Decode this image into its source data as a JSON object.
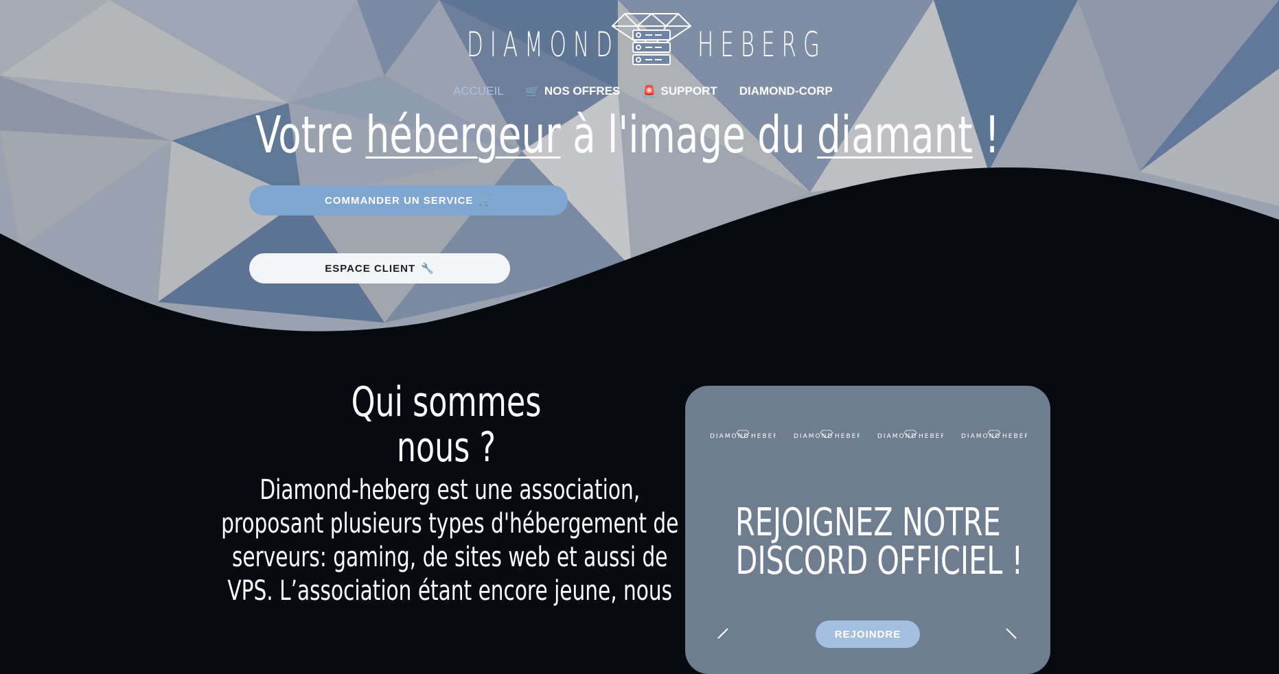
{
  "brand": {
    "name_left": "DIAMOND",
    "name_right": "HEBERG",
    "logo_icon": "diamond-server-icon"
  },
  "nav": {
    "items": [
      {
        "label": "ACCUEIL",
        "icon": "",
        "active": true
      },
      {
        "label": "NOS OFFRES",
        "icon": "cart-icon",
        "active": false
      },
      {
        "label": "SUPPORT",
        "icon": "siren-icon",
        "active": false
      },
      {
        "label": "DIAMOND-CORP",
        "icon": "",
        "active": false
      }
    ]
  },
  "hero": {
    "title_part1": "Votre ",
    "title_u1": "hébergeur",
    "title_part2": " à l'image du ",
    "title_u2": "diamant",
    "title_part3": " !",
    "order_button": "COMMANDER UN SERVICE",
    "order_icon": "cart-icon",
    "client_button": "ESPACE CLIENT",
    "client_icon": "wrench-icon"
  },
  "about": {
    "title": "Qui sommes nous ?",
    "text": "Diamond-heberg est une association, proposant plusieurs types d'hébergement de serveurs: gaming, de sites web et aussi de VPS. L’association étant encore jeune, nous"
  },
  "discord": {
    "heading_line1": "REJOIGNEZ NOTRE",
    "heading_line2": "DISCORD OFFICIEL !",
    "join_button": "REJOINDRE",
    "mini_logo_count": 4
  },
  "colors": {
    "background": "#070a11",
    "accent": "#7ea6d1",
    "nav_active": "#a9c4e4",
    "card": "#6e7d90",
    "join_button": "#a4bfe0"
  }
}
